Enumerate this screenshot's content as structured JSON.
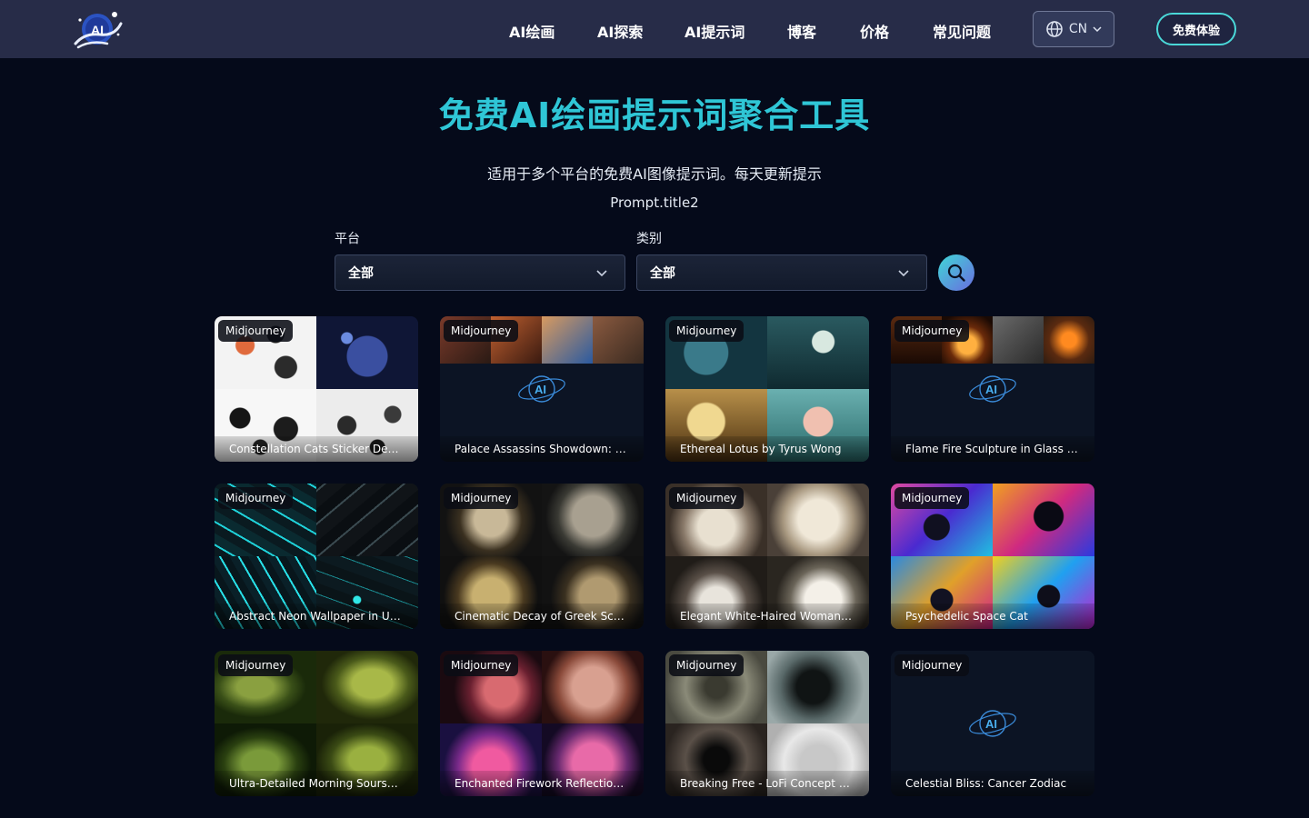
{
  "nav": {
    "items": [
      {
        "label": "AI绘画"
      },
      {
        "label": "AI探索"
      },
      {
        "label": "AI提示词"
      },
      {
        "label": "博客"
      },
      {
        "label": "价格"
      },
      {
        "label": "常见问题"
      }
    ],
    "language": "CN",
    "language_icon": "globe-icon",
    "cta_label": "免费体验"
  },
  "hero": {
    "title": "免费AI绘画提示词聚合工具",
    "subtitle": "适用于多个平台的免费AI图像提示词。每天更新提示",
    "subtitle2": "Prompt.title2"
  },
  "filters": {
    "platform_label": "平台",
    "platform_value": "全部",
    "category_label": "类别",
    "category_value": "全部",
    "search_icon": "search-icon"
  },
  "colors": {
    "accent": "#2fc6d6",
    "header_bg": "#272c48",
    "page_bg": "#050a1a"
  },
  "cards": [
    {
      "platform": "Midjourney",
      "title": "Constellation Cats Sticker Design"
    },
    {
      "platform": "Midjourney",
      "title": "Palace Assassins Showdown: Jasmine..."
    },
    {
      "platform": "Midjourney",
      "title": "Ethereal Lotus by Tyrus Wong"
    },
    {
      "platform": "Midjourney",
      "title": "Flame Fire Sculpture in Glass Case"
    },
    {
      "platform": "Midjourney",
      "title": "Abstract Neon Wallpaper in Unreal Engine"
    },
    {
      "platform": "Midjourney",
      "title": "Cinematic Decay of Greek Sculpture"
    },
    {
      "platform": "Midjourney",
      "title": "Elegant White-Haired Woman in Fur"
    },
    {
      "platform": "Midjourney",
      "title": "Psychedelic Space Cat"
    },
    {
      "platform": "Midjourney",
      "title": "Ultra-Detailed Morning Soursop Leaves"
    },
    {
      "platform": "Midjourney",
      "title": "Enchanted Firework Reflection in Alpaca"
    },
    {
      "platform": "Midjourney",
      "title": "Breaking Free - LoFi Concept Art"
    },
    {
      "platform": "Midjourney",
      "title": "Celestial Bliss: Cancer Zodiac"
    }
  ]
}
